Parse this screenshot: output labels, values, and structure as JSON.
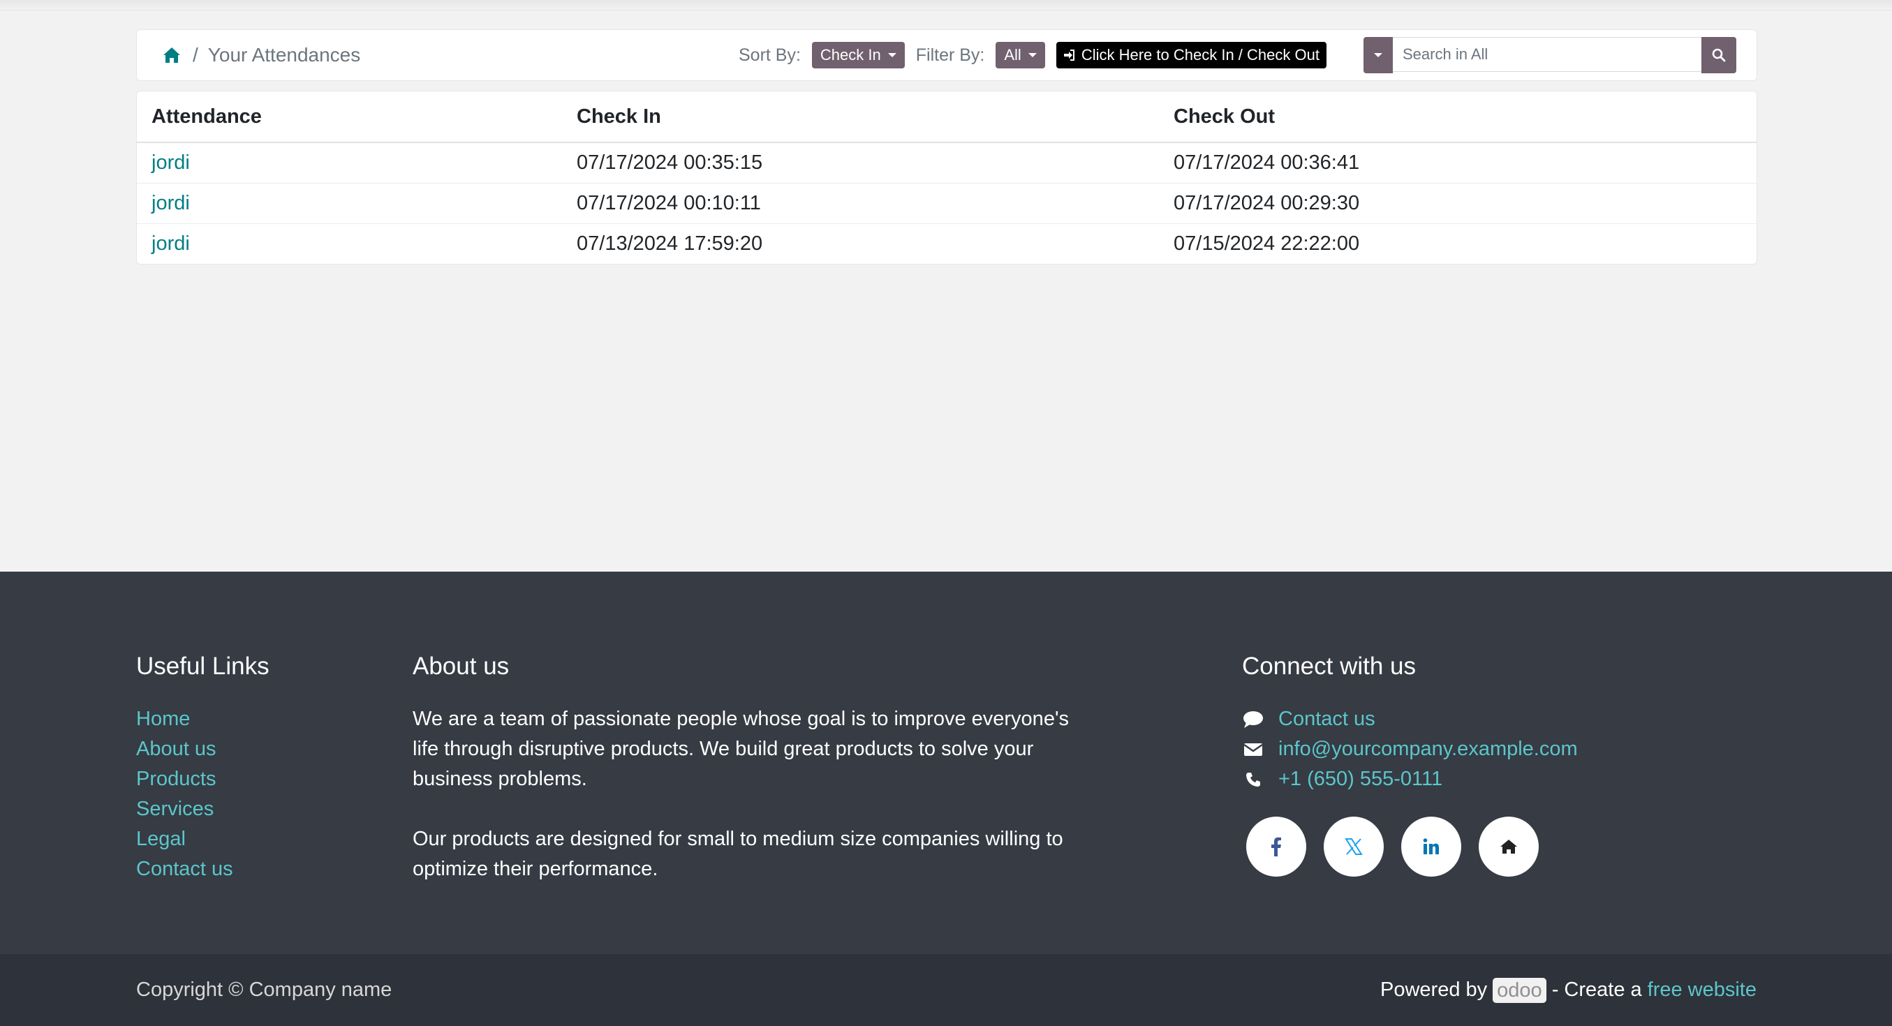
{
  "breadcrumb": {
    "current": "Your Attendances",
    "separator": "/"
  },
  "toolbar": {
    "sort_label": "Sort By:",
    "sort_value": "Check In",
    "filter_label": "Filter By:",
    "filter_value": "All",
    "check_button": "Click Here to Check In / Check Out",
    "search_placeholder": "Search in All"
  },
  "table": {
    "headers": [
      "Attendance",
      "Check In",
      "Check Out"
    ],
    "rows": [
      {
        "name": "jordi",
        "check_in": "07/17/2024 00:35:15",
        "check_out": "07/17/2024 00:36:41"
      },
      {
        "name": "jordi",
        "check_in": "07/17/2024 00:10:11",
        "check_out": "07/17/2024 00:29:30"
      },
      {
        "name": "jordi",
        "check_in": "07/13/2024 17:59:20",
        "check_out": "07/15/2024 22:22:00"
      }
    ]
  },
  "footer": {
    "useful_links": {
      "heading": "Useful Links",
      "items": [
        "Home",
        "About us",
        "Products",
        "Services",
        "Legal",
        "Contact us"
      ]
    },
    "about": {
      "heading": "About us",
      "p1": "We are a team of passionate people whose goal is to improve everyone's life through disruptive products. We build great products to solve your business problems.",
      "p2": "Our products are designed for small to medium size companies willing to optimize their performance."
    },
    "connect": {
      "heading": "Connect with us",
      "contact": "Contact us",
      "email": "info@yourcompany.example.com",
      "phone": "+1 (650) 555-0111",
      "socials": [
        "facebook-icon",
        "x-twitter-icon",
        "linkedin-icon",
        "home-icon"
      ]
    },
    "copyright": "Copyright © Company name",
    "powered_by": "Powered by",
    "odoo": "odoo",
    "create_text": "- Create a",
    "free_website": "free website"
  },
  "colors": {
    "accent": "#71606e",
    "link": "#017e84",
    "footer_link": "#5cc6ca",
    "footer_bg": "#363b44",
    "bottom_bg": "#2e323a"
  }
}
